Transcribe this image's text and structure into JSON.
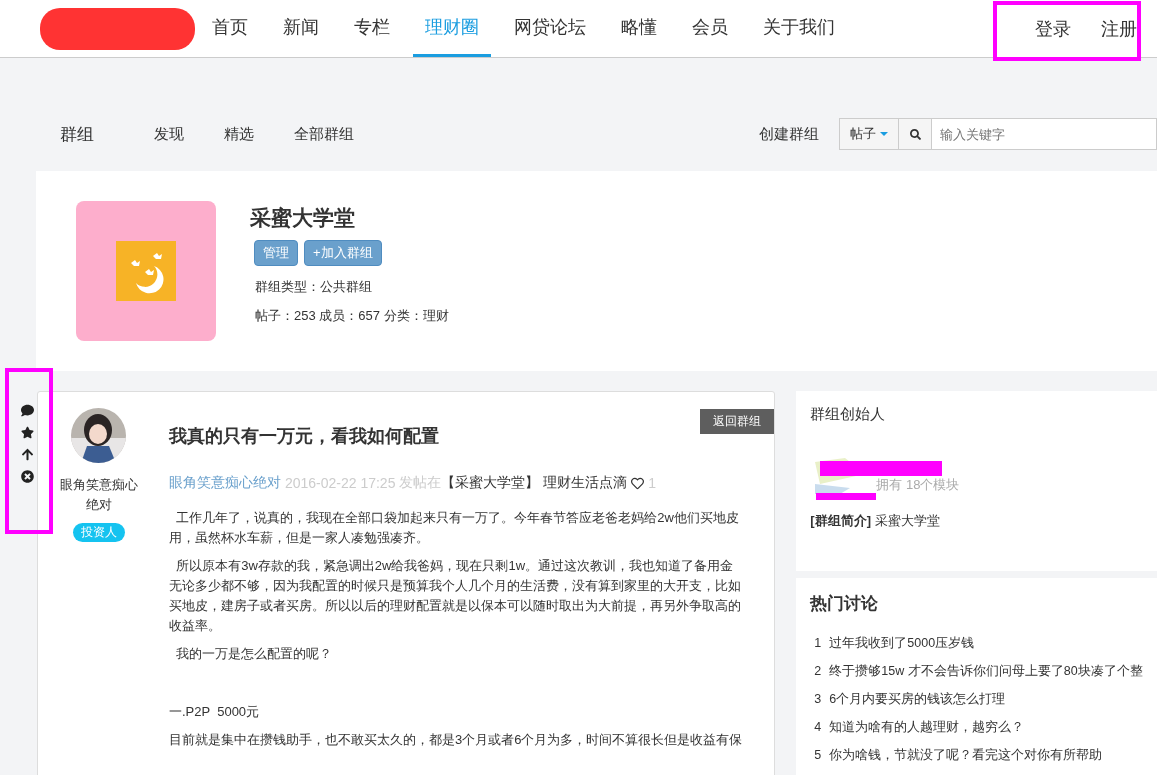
{
  "nav": {
    "items": [
      {
        "label": "首页",
        "selected": false
      },
      {
        "label": "新闻",
        "selected": false
      },
      {
        "label": "专栏",
        "selected": false
      },
      {
        "label": "理财圈",
        "selected": true
      },
      {
        "label": "网贷论坛",
        "selected": false
      },
      {
        "label": "略懂",
        "selected": false
      },
      {
        "label": "会员",
        "selected": false
      },
      {
        "label": "关于我们",
        "selected": false
      }
    ],
    "auth": [
      "登录",
      "注册"
    ]
  },
  "subnav": {
    "title": "群组",
    "links": [
      "发现",
      "精选",
      "全部群组"
    ],
    "create": "创建群组",
    "search": {
      "scope": "帖子",
      "placeholder": "输入关键字"
    }
  },
  "group": {
    "name": "采蜜大学堂",
    "buttons": [
      "管理",
      "+加入群组"
    ],
    "type": "群组类型：公共群组",
    "stats": "帖子：253 成员：657 分类：理财"
  },
  "post": {
    "author": "眼角笑意痴心绝对",
    "badge": "投资人",
    "back": "返回群组",
    "title": "我真的只有一万元，看我如何配置",
    "meta": {
      "author": "眼角笑意痴心绝对",
      "time": "2016-02-22 17:25",
      "posted_in": "发帖在",
      "group": "【采蜜大学堂】",
      "category": "理财生活点滴",
      "likes": "1"
    },
    "paragraphs": [
      "  工作几年了，说真的，我现在全部口袋加起来只有一万了。今年春节答应老爸老妈给2w他们买地皮用，虽然杯水车薪，但是一家人凑勉强凑齐。",
      "  所以原本有3w存款的我，紧急调出2w给我爸妈，现在只剩1w。通过这次教训，我也知道了备用金无论多少都不够，因为我配置的时候只是预算我个人几个月的生活费，没有算到家里的大开支，比如买地皮，建房子或者买房。所以以后的理财配置就是以保本可以随时取出为大前提，再另外争取高的收益率。",
      "  我的一万是怎么配置的呢？",
      "一.P2P  5000元",
      "目前就是集中在攒钱助手，也不敢买太久的，都是3个月或者6个月为多，时间不算很长但是收益有保"
    ]
  },
  "founder": {
    "title": "群组创始人",
    "owns": "拥有 18个模块",
    "intro_label": "[群组简介]",
    "intro": "采蜜大学堂"
  },
  "hot": {
    "title": "热门讨论",
    "items": [
      {
        "rank": "1",
        "title": "过年我收到了5000压岁钱"
      },
      {
        "rank": "2",
        "title": "终于攒够15w 才不会告诉你们问母上要了80块凑了个整"
      },
      {
        "rank": "3",
        "title": "6个月内要买房的钱该怎么打理"
      },
      {
        "rank": "4",
        "title": "知道为啥有的人越理财，越穷么？"
      },
      {
        "rank": "5",
        "title": "你为啥钱，节就没了呢？看完这个对你有所帮助"
      }
    ]
  }
}
